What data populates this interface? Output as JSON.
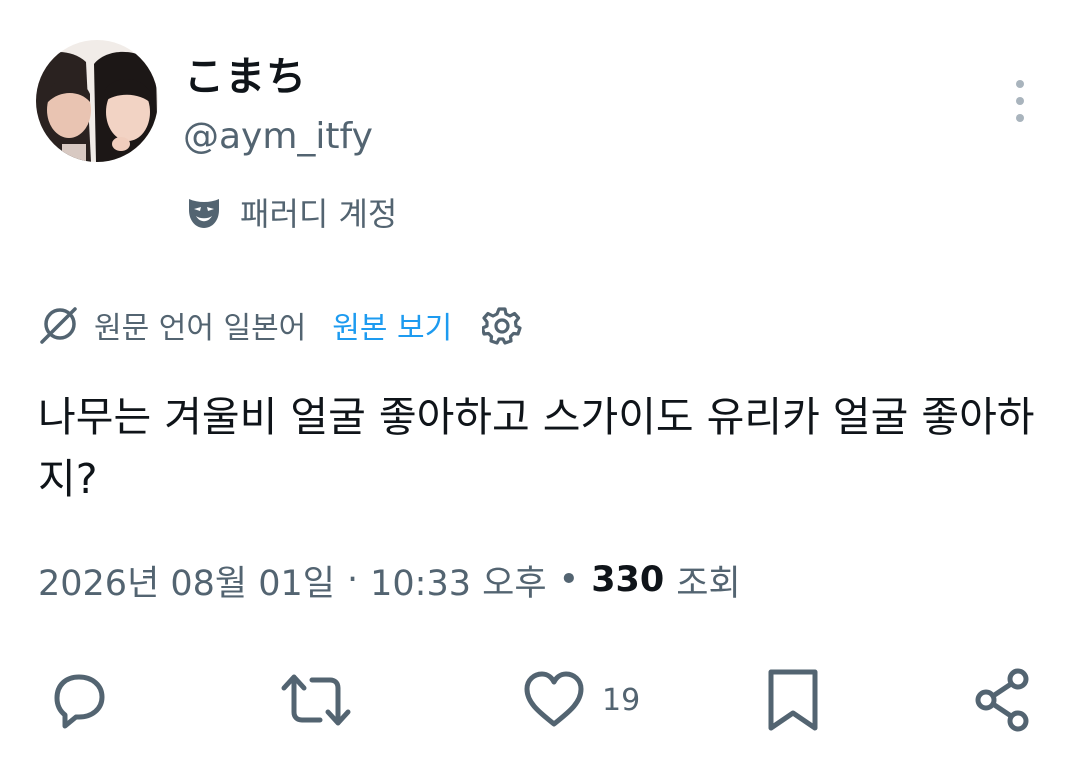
{
  "author": {
    "display_name": "こまち",
    "handle": "@aym_itfy",
    "parody_label": "패러디 계정",
    "avatar_icon": "avatar-photo"
  },
  "translation": {
    "source_language": "원문 언어 일본어",
    "show_original": "원본 보기",
    "link_color": "#1d9bf0"
  },
  "tweet": {
    "text": "나무는 겨울비 얼굴 좋아하고 스가이도 유리카 얼굴 좋아하지?",
    "date": "2026년 08월 01일",
    "separator": "·",
    "time": "10:33 오후",
    "views_separator": "•",
    "views_count": "330",
    "views_label": "조회"
  },
  "actions": {
    "reply_icon": "reply-icon",
    "retweet_icon": "retweet-icon",
    "like_icon": "heart-icon",
    "like_count": "19",
    "bookmark_icon": "bookmark-icon",
    "share_icon": "share-icon"
  },
  "colors": {
    "text": "#0f1419",
    "secondary": "#536471",
    "accent": "#1d9bf0"
  }
}
